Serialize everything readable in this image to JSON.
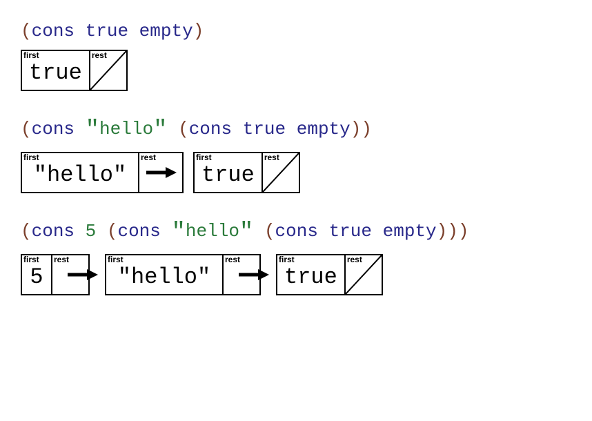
{
  "labels": {
    "first": "first",
    "rest": "rest"
  },
  "tokens": {
    "cons": "cons",
    "true": "true",
    "empty": "empty",
    "hello": "hello",
    "five": "5",
    "lp": "(",
    "rp": ")",
    "dq": "\""
  },
  "examples": [
    {
      "code_tokens": [
        {
          "t": "paren",
          "k": "lp"
        },
        {
          "t": "ident",
          "k": "cons"
        },
        {
          "t": "sp"
        },
        {
          "t": "ident",
          "k": "true"
        },
        {
          "t": "sp"
        },
        {
          "t": "ident",
          "k": "empty"
        },
        {
          "t": "paren",
          "k": "rp"
        }
      ],
      "cells": [
        {
          "first_type": "ident",
          "first_key": "true",
          "rest": "empty"
        }
      ]
    },
    {
      "code_tokens": [
        {
          "t": "paren",
          "k": "lp"
        },
        {
          "t": "ident",
          "k": "cons"
        },
        {
          "t": "sp"
        },
        {
          "t": "quote",
          "k": "dq"
        },
        {
          "t": "string",
          "k": "hello"
        },
        {
          "t": "quote",
          "k": "dq"
        },
        {
          "t": "sp"
        },
        {
          "t": "paren",
          "k": "lp"
        },
        {
          "t": "ident",
          "k": "cons"
        },
        {
          "t": "sp"
        },
        {
          "t": "ident",
          "k": "true"
        },
        {
          "t": "sp"
        },
        {
          "t": "ident",
          "k": "empty"
        },
        {
          "t": "paren",
          "k": "rp"
        },
        {
          "t": "paren",
          "k": "rp"
        }
      ],
      "cells": [
        {
          "first_type": "string",
          "first_key": "hello",
          "rest": "arrow"
        },
        {
          "first_type": "ident",
          "first_key": "true",
          "rest": "empty"
        }
      ]
    },
    {
      "code_tokens": [
        {
          "t": "paren",
          "k": "lp"
        },
        {
          "t": "ident",
          "k": "cons"
        },
        {
          "t": "sp"
        },
        {
          "t": "number",
          "k": "five"
        },
        {
          "t": "sp"
        },
        {
          "t": "paren",
          "k": "lp"
        },
        {
          "t": "ident",
          "k": "cons"
        },
        {
          "t": "sp"
        },
        {
          "t": "quote",
          "k": "dq"
        },
        {
          "t": "string",
          "k": "hello"
        },
        {
          "t": "quote",
          "k": "dq"
        },
        {
          "t": "sp"
        },
        {
          "t": "paren",
          "k": "lp"
        },
        {
          "t": "ident",
          "k": "cons"
        },
        {
          "t": "sp"
        },
        {
          "t": "ident",
          "k": "true"
        },
        {
          "t": "sp"
        },
        {
          "t": "ident",
          "k": "empty"
        },
        {
          "t": "paren",
          "k": "rp"
        },
        {
          "t": "paren",
          "k": "rp"
        },
        {
          "t": "paren",
          "k": "rp"
        }
      ],
      "cells": [
        {
          "first_type": "number",
          "first_key": "five",
          "rest": "arrow"
        },
        {
          "first_type": "string",
          "first_key": "hello",
          "rest": "arrow"
        },
        {
          "first_type": "ident",
          "first_key": "true",
          "rest": "empty"
        }
      ]
    }
  ]
}
